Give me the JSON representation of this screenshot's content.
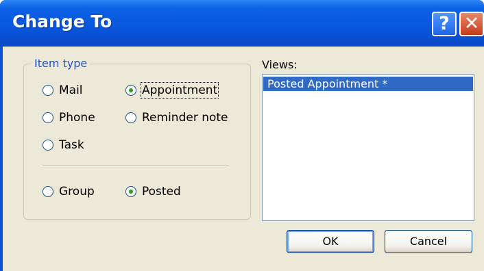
{
  "window": {
    "title": "Change To",
    "help_label": "?",
    "close_label": "✕"
  },
  "item_type": {
    "label": "Item type",
    "options": [
      {
        "label": "Mail",
        "selected": false
      },
      {
        "label": "Appointment",
        "selected": true
      },
      {
        "label": "Phone",
        "selected": false
      },
      {
        "label": "Reminder note",
        "selected": false
      },
      {
        "label": "Task",
        "selected": false
      }
    ],
    "category_options": [
      {
        "label": "Group",
        "selected": false
      },
      {
        "label": "Posted",
        "selected": true
      }
    ]
  },
  "views": {
    "label": "Views:",
    "items": [
      "Posted Appointment *"
    ],
    "selected_index": 0
  },
  "buttons": {
    "ok_label": "OK",
    "cancel_label": "Cancel"
  },
  "colors": {
    "titlebar": "#0a56dc",
    "dialog_bg": "#ece9d8",
    "selection": "#316ac5",
    "group_label": "#1f50d0"
  }
}
